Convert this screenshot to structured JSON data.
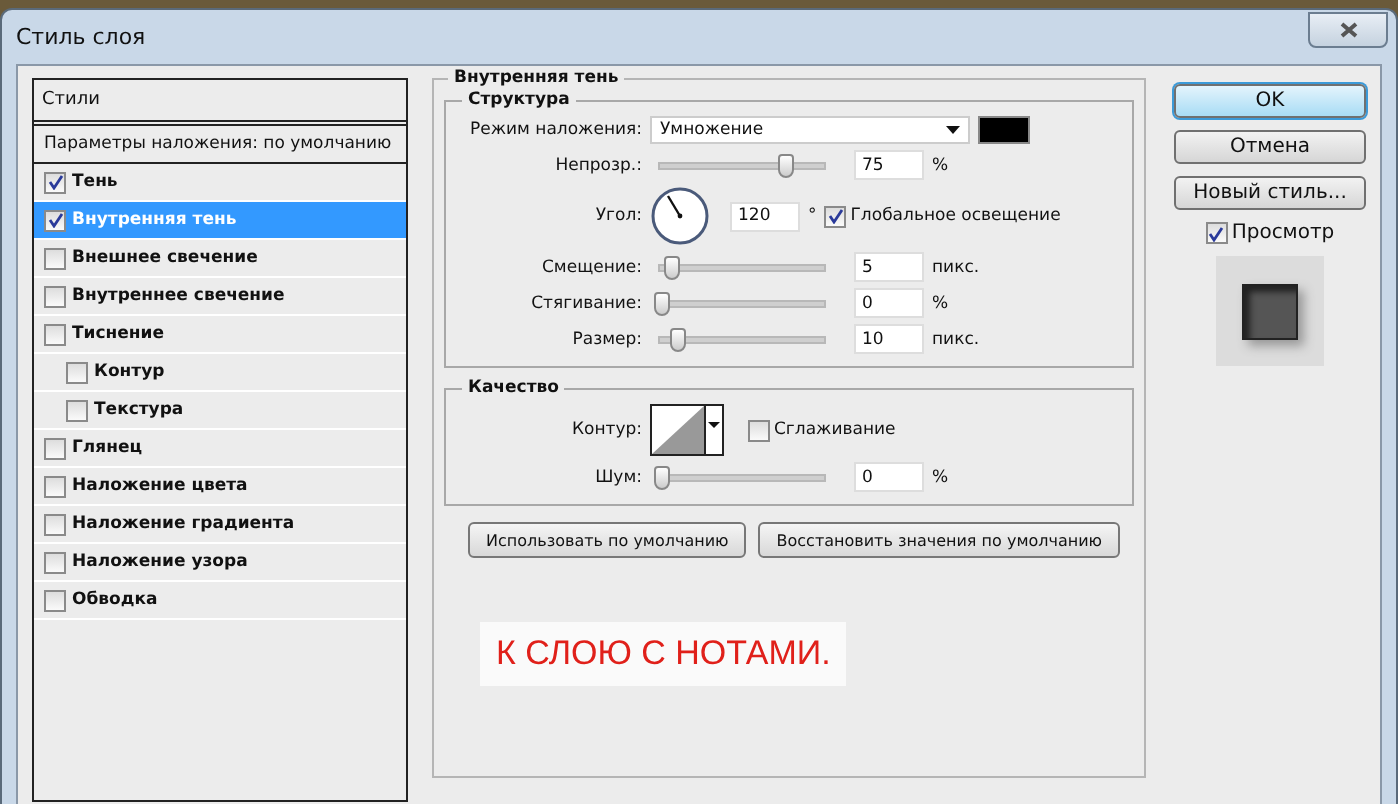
{
  "window": {
    "title": "Стиль слоя"
  },
  "styles_panel": {
    "header": "Стили",
    "blending_options": "Параметры наложения: по умолчанию",
    "items": [
      {
        "label": "Тень",
        "checked": true,
        "selected": false
      },
      {
        "label": "Внутренняя тень",
        "checked": true,
        "selected": true
      },
      {
        "label": "Внешнее свечение",
        "checked": false,
        "selected": false
      },
      {
        "label": "Внутреннее свечение",
        "checked": false,
        "selected": false
      },
      {
        "label": "Тиснение",
        "checked": false,
        "selected": false,
        "children": [
          {
            "label": "Контур",
            "checked": false,
            "selected": false
          },
          {
            "label": "Текстура",
            "checked": false,
            "selected": false
          }
        ]
      },
      {
        "label": "Глянец",
        "checked": false,
        "selected": false
      },
      {
        "label": "Наложение цвета",
        "checked": false,
        "selected": false
      },
      {
        "label": "Наложение градиента",
        "checked": false,
        "selected": false
      },
      {
        "label": "Наложение узора",
        "checked": false,
        "selected": false
      },
      {
        "label": "Обводка",
        "checked": false,
        "selected": false
      }
    ]
  },
  "inner_shadow": {
    "title": "Внутренняя тень",
    "structure": {
      "title": "Структура",
      "blend_mode_label": "Режим наложения:",
      "blend_mode": "Умножение",
      "color": "#000000",
      "opacity": {
        "label": "Непрозр.:",
        "level": 0.75,
        "value": "75",
        "unit": "%"
      },
      "angle": {
        "label": "Угол:",
        "value": "120",
        "unit": "°"
      },
      "global_light": {
        "label": "Глобальное освещение",
        "checked": true
      },
      "sliders": [
        {
          "label": "Смещение:",
          "level": 0.06,
          "value": "5",
          "unit": "пикс."
        },
        {
          "label": "Стягивание:",
          "level": 0,
          "value": "0",
          "unit": "%"
        },
        {
          "label": "Размер:",
          "level": 0.1,
          "value": "10",
          "unit": "пикс."
        }
      ]
    },
    "quality": {
      "title": "Качество",
      "contour_label": "Контур:",
      "anti_alias": {
        "label": "Сглаживание",
        "checked": false
      },
      "noise": {
        "label": "Шум:",
        "level": 0,
        "value": "0",
        "unit": "%"
      }
    },
    "buttons": [
      "Использовать по умолчанию",
      "Восстановить значения по умолчанию"
    ]
  },
  "caption": "К СЛОЮ С НОТАМИ.",
  "actions": {
    "ok": "OK",
    "cancel": "Отмена",
    "new_style": "Новый стиль...",
    "preview": {
      "label": "Просмотр",
      "checked": true
    }
  }
}
